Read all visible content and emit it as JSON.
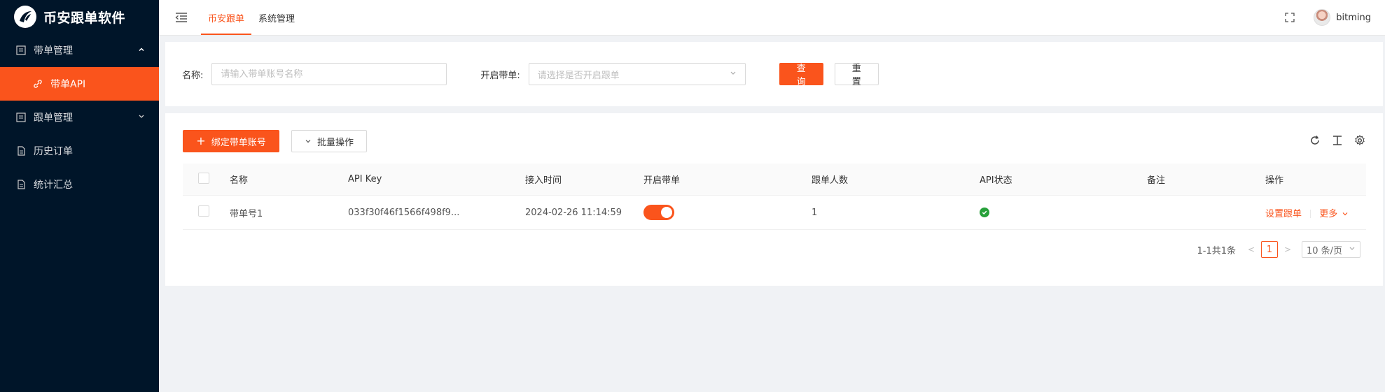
{
  "app": {
    "title": "币安跟单软件"
  },
  "sidebar": {
    "items": [
      {
        "label": "带单管理",
        "expanded": true,
        "children": [
          {
            "label": "带单API",
            "active": true
          }
        ]
      },
      {
        "label": "跟单管理",
        "expanded": false
      },
      {
        "label": "历史订单"
      },
      {
        "label": "统计汇总"
      }
    ]
  },
  "header": {
    "tabs": [
      {
        "label": "币安跟单",
        "active": true
      },
      {
        "label": "系统管理",
        "active": false
      }
    ],
    "username": "bitming"
  },
  "search": {
    "name_label": "名称:",
    "name_placeholder": "请输入带单账号名称",
    "enable_label": "开启带单:",
    "enable_placeholder": "请选择是否开启跟单",
    "query_button": "查 询",
    "reset_button": "重 置"
  },
  "toolbar": {
    "bind_button": "绑定带单账号",
    "batch_button": "批量操作"
  },
  "table": {
    "columns": [
      "名称",
      "API Key",
      "接入时间",
      "开启带单",
      "跟单人数",
      "API状态",
      "备注",
      "操作"
    ],
    "rows": [
      {
        "name": "带单号1",
        "api_key": "033f30f46f1566f498f9...",
        "time": "2024-02-26 11:14:59",
        "enabled": true,
        "followers": "1",
        "api_status": "ok",
        "remark": "",
        "op_setting": "设置跟单",
        "op_more": "更多"
      }
    ]
  },
  "pagination": {
    "summary": "1-1共1条",
    "current_page": "1",
    "page_size": "10 条/页"
  },
  "colors": {
    "accent": "#fa541c",
    "sider": "#001529",
    "status_ok": "#27a03a"
  }
}
